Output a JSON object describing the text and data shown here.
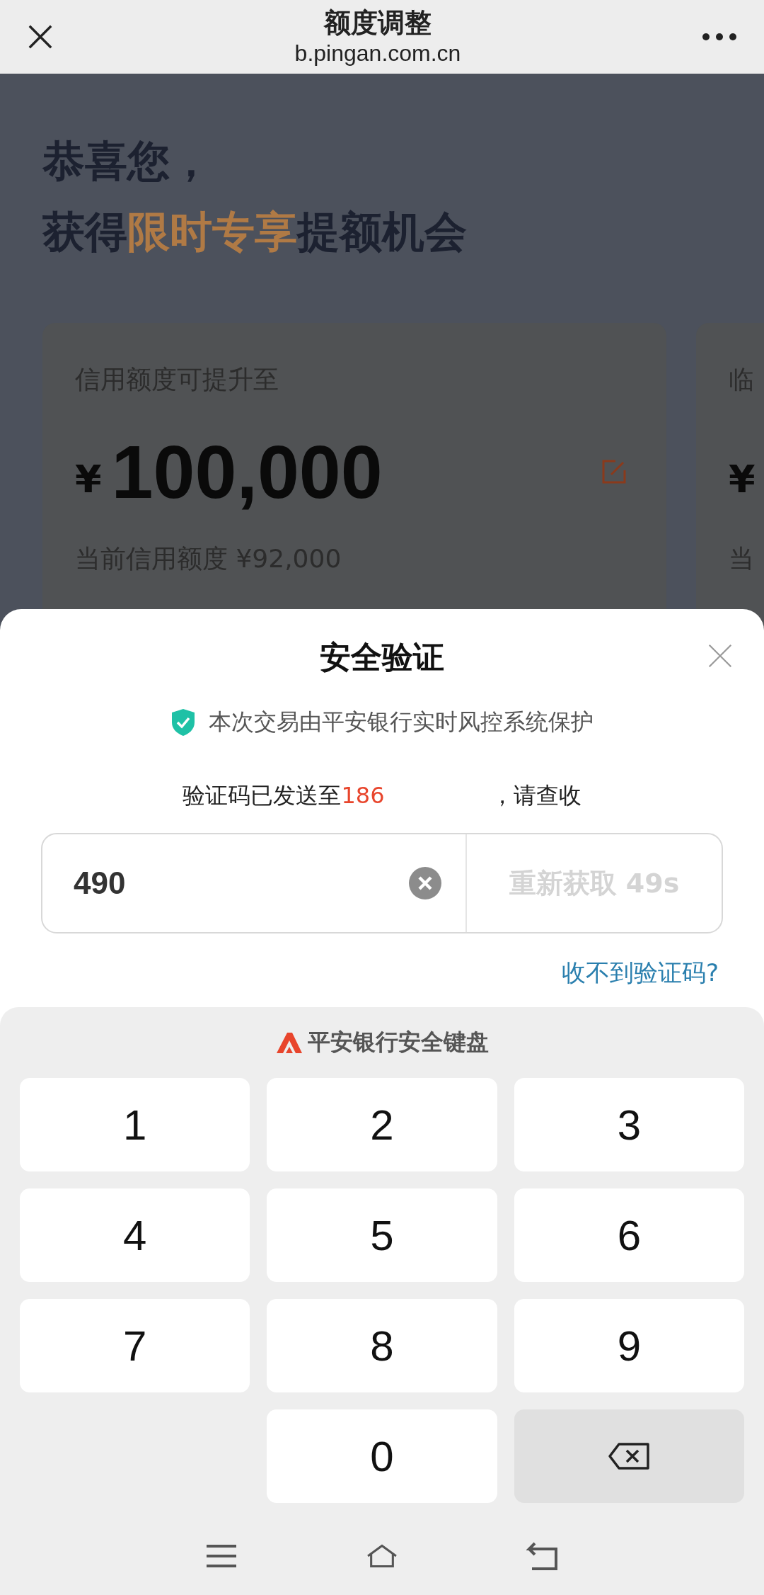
{
  "top_bar": {
    "title": "额度调整",
    "subtitle": "b.pingan.com.cn"
  },
  "promo": {
    "line1": "恭喜您，",
    "line2": [
      {
        "text": "获得",
        "highlight": false
      },
      {
        "text": "限时专享",
        "highlight": true
      },
      {
        "text": "提额机会",
        "highlight": false
      }
    ]
  },
  "cards": [
    {
      "label": "信用额度可提升至",
      "currency": "¥",
      "amount": "100,000",
      "note": "当前信用额度 ¥92,000"
    },
    {
      "label": "临",
      "currency": "¥",
      "note": "当"
    }
  ],
  "dialog": {
    "title": "安全验证",
    "security_note": "本次交易由平安银行实时风控系统保护",
    "sent_prefix": "验证码已发送至",
    "phone": "186",
    "sent_suffix": "，请查收",
    "code_value": "490",
    "resend": "重新获取 49s",
    "resend_disabled": true,
    "help_link": "收不到验证码?"
  },
  "keyboard": {
    "title": "平安银行安全键盘",
    "keys": [
      {
        "kind": "digit",
        "label": "1"
      },
      {
        "kind": "digit",
        "label": "2"
      },
      {
        "kind": "digit",
        "label": "3"
      },
      {
        "kind": "digit",
        "label": "4"
      },
      {
        "kind": "digit",
        "label": "5"
      },
      {
        "kind": "digit",
        "label": "6"
      },
      {
        "kind": "digit",
        "label": "7"
      },
      {
        "kind": "digit",
        "label": "8"
      },
      {
        "kind": "digit",
        "label": "9"
      },
      {
        "kind": "blank"
      },
      {
        "kind": "digit",
        "label": "0"
      },
      {
        "kind": "delete"
      }
    ]
  }
}
